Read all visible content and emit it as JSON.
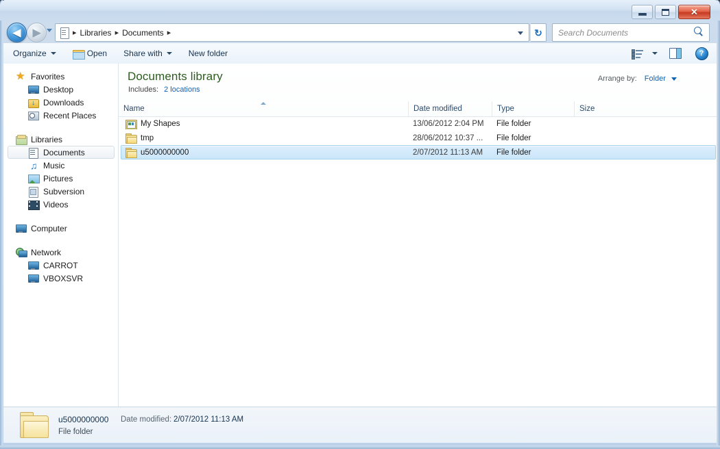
{
  "window": {
    "title": "",
    "controls": {
      "minimize": "Minimize",
      "maximize": "Maximize",
      "close": "✕"
    }
  },
  "navigation": {
    "back_label": "◀",
    "forward_label": "▶",
    "history_label": "Recent pages",
    "breadcrumb": [
      {
        "label": "Libraries",
        "separator": "▸"
      },
      {
        "label": "Documents",
        "separator": "▸"
      }
    ],
    "address_icon": "library-icon",
    "refresh_label": "↻"
  },
  "search": {
    "placeholder": "Search Documents",
    "icon": "search-icon"
  },
  "toolbar": {
    "organize_label": "Organize",
    "open_label": "Open",
    "share_label": "Share with",
    "new_folder_label": "New folder",
    "views_label": "Change your view",
    "preview_label": "Show the preview pane",
    "help_label": "?"
  },
  "sidebar": {
    "items": [
      {
        "label": "Favorites",
        "icon": "favorites-star-icon",
        "level": "group",
        "selected": false
      },
      {
        "label": "Desktop",
        "icon": "desktop-icon",
        "level": "child",
        "selected": false
      },
      {
        "label": "Downloads",
        "icon": "downloads-icon",
        "level": "child",
        "selected": false
      },
      {
        "label": "Recent Places",
        "icon": "recent-places-icon",
        "level": "child",
        "selected": false
      },
      {
        "label": "Libraries",
        "icon": "libraries-icon",
        "level": "group",
        "selected": false
      },
      {
        "label": "Documents",
        "icon": "documents-icon",
        "level": "child",
        "selected": true
      },
      {
        "label": "Music",
        "icon": "music-icon",
        "level": "child",
        "selected": false
      },
      {
        "label": "Pictures",
        "icon": "pictures-icon",
        "level": "child",
        "selected": false
      },
      {
        "label": "Subversion",
        "icon": "subversion-icon",
        "level": "child",
        "selected": false
      },
      {
        "label": "Videos",
        "icon": "videos-icon",
        "level": "child",
        "selected": false
      },
      {
        "label": "Computer",
        "icon": "computer-icon",
        "level": "group",
        "selected": false
      },
      {
        "label": "Network",
        "icon": "network-globe-icon",
        "level": "group",
        "selected": false
      },
      {
        "label": "CARROT",
        "icon": "computer-icon",
        "level": "child",
        "selected": false
      },
      {
        "label": "VBOXSVR",
        "icon": "computer-icon",
        "level": "child",
        "selected": false
      }
    ]
  },
  "library_header": {
    "title": "Documents library",
    "includes_label": "Includes:",
    "includes_link": "2 locations",
    "arrange_label": "Arrange by:",
    "arrange_value": "Folder"
  },
  "file_list": {
    "columns": [
      {
        "label": "Name",
        "sorted": "asc"
      },
      {
        "label": "Date modified",
        "sorted": ""
      },
      {
        "label": "Type",
        "sorted": ""
      },
      {
        "label": "Size",
        "sorted": ""
      }
    ],
    "rows": [
      {
        "name": "My Shapes",
        "date_modified": "13/06/2012 2:04 PM",
        "type": "File folder",
        "size": "",
        "icon": "my-shapes-folder-icon",
        "selected": false
      },
      {
        "name": "tmp",
        "date_modified": "28/06/2012 10:37 ...",
        "type": "File folder",
        "size": "",
        "icon": "folder-icon",
        "selected": false
      },
      {
        "name": "u5000000000",
        "date_modified": "2/07/2012 11:13 AM",
        "type": "File folder",
        "size": "",
        "icon": "folder-icon",
        "selected": true
      }
    ]
  },
  "details_pane": {
    "name": "u5000000000",
    "date_modified_label": "Date modified:",
    "date_modified_value": "2/07/2012 11:13 AM",
    "type": "File folder",
    "icon": "folder-icon-large"
  },
  "colors": {
    "accent_link": "#0f62b4",
    "library_title": "#2c5c1e",
    "selection_fill": "#cbe6fa",
    "selection_border": "#a6d2ee",
    "close_button": "#c63a21",
    "folder_yellow": "#eec95e"
  }
}
